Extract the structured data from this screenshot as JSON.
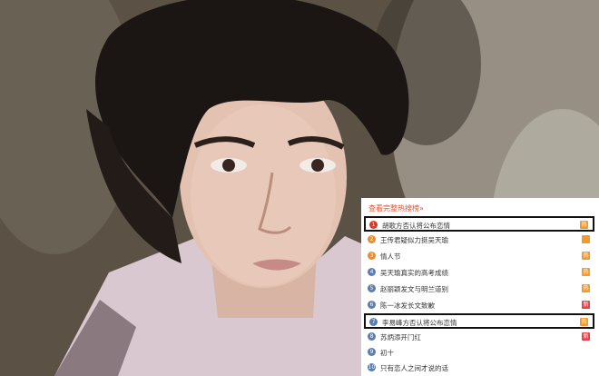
{
  "photo": {
    "description_icon": "portrait-photo"
  },
  "hot_search": {
    "title": "查看完整热搜榜»",
    "items": [
      {
        "rank": "1",
        "label": "胡歌方否认将公布恋情",
        "badge": "热",
        "rank_color": "red",
        "badge_type": "hot",
        "highlighted": true
      },
      {
        "rank": "2",
        "label": "王传君疑似力挺吴天瑜",
        "badge": "",
        "rank_color": "orange",
        "badge_type": "hot",
        "highlighted": false
      },
      {
        "rank": "3",
        "label": "情人节",
        "badge": "热",
        "rank_color": "orange",
        "badge_type": "hot",
        "highlighted": false
      },
      {
        "rank": "4",
        "label": "吴天瑜真实的高考成绩",
        "badge": "热",
        "rank_color": "blue",
        "badge_type": "hot",
        "highlighted": false
      },
      {
        "rank": "5",
        "label": "赵丽颖发文与明兰道别",
        "badge": "热",
        "rank_color": "blue",
        "badge_type": "hot",
        "highlighted": false
      },
      {
        "rank": "6",
        "label": "陈一冰发长文致歉",
        "badge": "新",
        "rank_color": "blue",
        "badge_type": "new",
        "highlighted": false
      },
      {
        "rank": "7",
        "label": "李易峰方否认将公布恋情",
        "badge": "热",
        "rank_color": "blue",
        "badge_type": "hot",
        "highlighted": true
      },
      {
        "rank": "8",
        "label": "苏炳添开门红",
        "badge": "新",
        "rank_color": "blue",
        "badge_type": "new",
        "highlighted": false
      },
      {
        "rank": "9",
        "label": "初十",
        "badge": "",
        "rank_color": "blue",
        "badge_type": "none",
        "highlighted": false
      },
      {
        "rank": "10",
        "label": "只有恋人之间才说的话",
        "badge": "",
        "rank_color": "blue",
        "badge_type": "none",
        "highlighted": false
      }
    ]
  }
}
